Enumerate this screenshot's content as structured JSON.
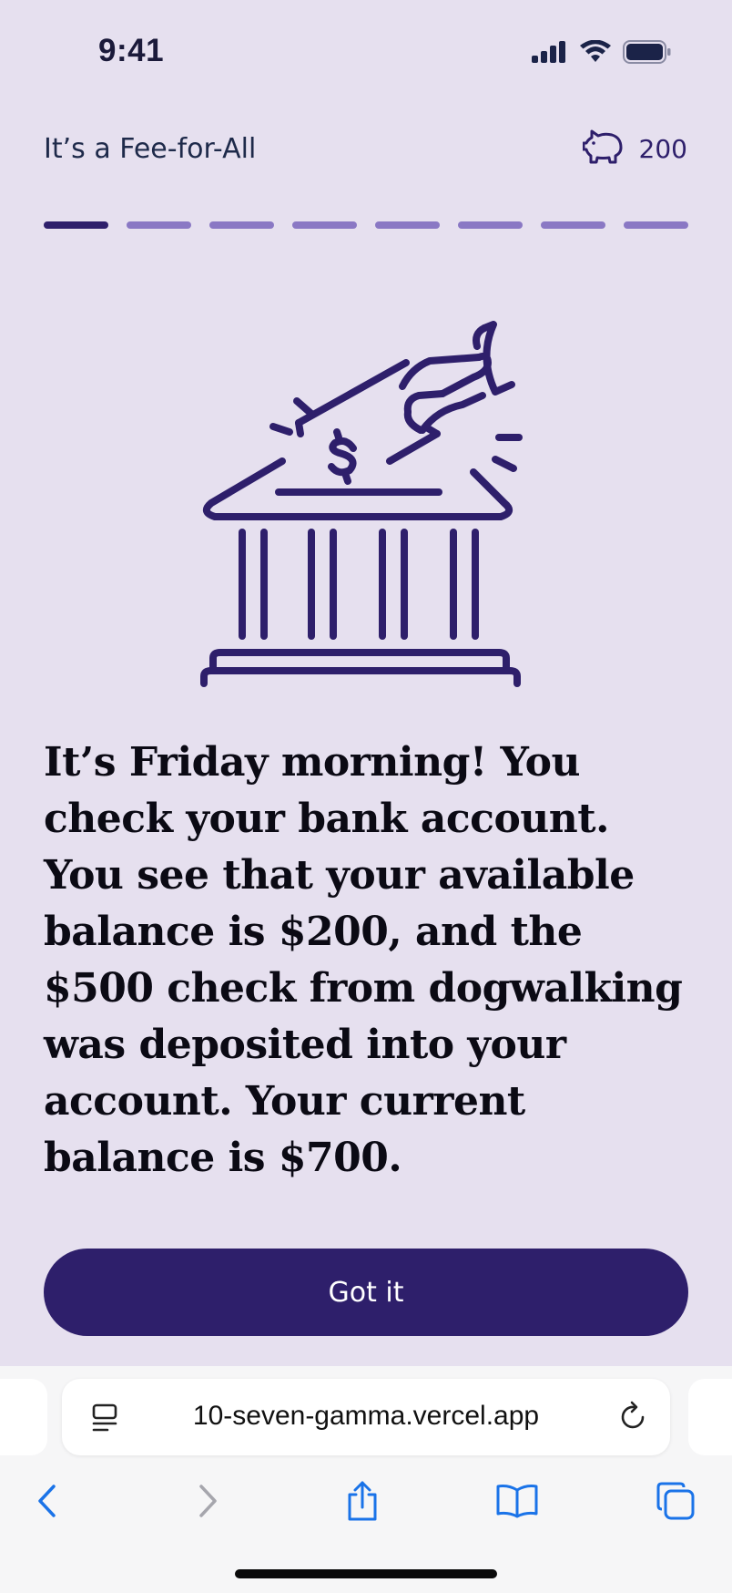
{
  "status_bar": {
    "time": "9:41",
    "icons": [
      "signal-icon",
      "wifi-icon",
      "battery-icon"
    ]
  },
  "header": {
    "title": "It’s a Fee-for-All",
    "points_icon": "piggy-bank-icon",
    "points": "200"
  },
  "progress": {
    "total_steps": 8,
    "current_step": 1
  },
  "illustration": {
    "icon": "bank-deposit-icon"
  },
  "story": {
    "text": "It’s Friday morning! You check your bank account. You see that your available balance is $200, and the $500 check from dogwalking was deposited into your account. Your current balance is $700."
  },
  "actions": {
    "primary_label": "Got it"
  },
  "browser": {
    "url": "10-seven-gamma.vercel.app",
    "toolbar": [
      "back-icon",
      "forward-icon",
      "share-icon",
      "bookmarks-icon",
      "tabs-icon"
    ]
  },
  "colors": {
    "background": "#e6e0ef",
    "brand": "#2e1f6b",
    "progress_inactive": "#8a78c4",
    "browser_accent": "#1a73e8"
  }
}
